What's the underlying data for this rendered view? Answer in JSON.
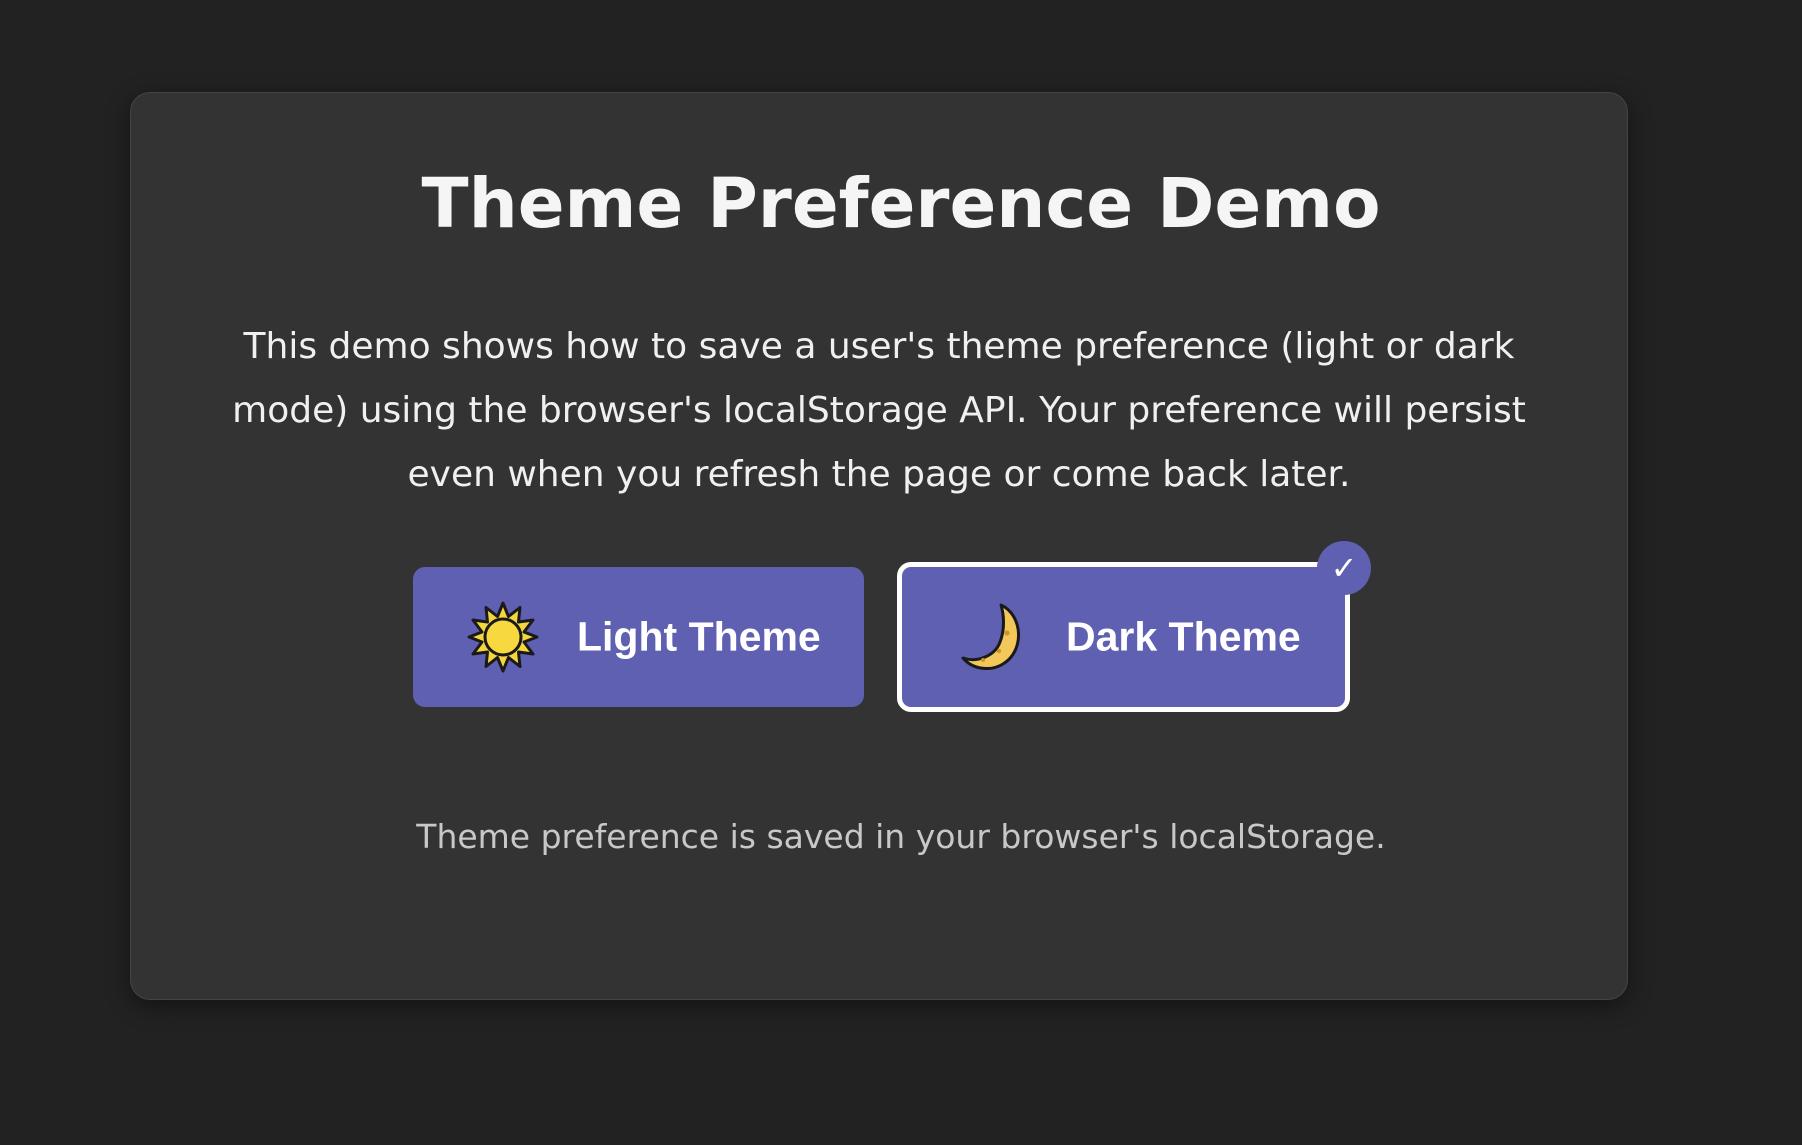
{
  "page": {
    "title": "Theme Preference Demo",
    "description": "This demo shows how to save a user's theme preference (light or dark mode) using the browser's localStorage API. Your preference will persist even when you refresh the page or come back later.",
    "footer_note": "Theme preference is saved in your browser's localStorage."
  },
  "buttons": {
    "light": {
      "label": "Light Theme",
      "icon": "sun-icon",
      "selected": false
    },
    "dark": {
      "label": "Dark Theme",
      "icon": "moon-icon",
      "selected": true
    }
  },
  "selected_badge": "✓",
  "colors": {
    "background": "#222222",
    "card": "#333333",
    "button": "#6060b3",
    "selected_border": "#ffffff",
    "sun": "#f5d63d",
    "moon": "#f2c85b"
  }
}
